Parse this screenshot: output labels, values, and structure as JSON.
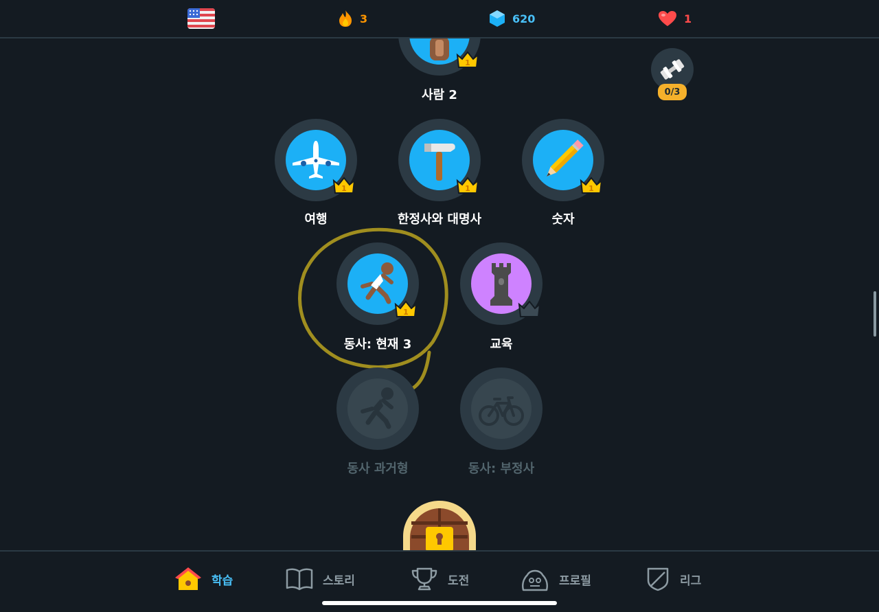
{
  "header": {
    "flag_icon": "us-flag-icon",
    "streak": {
      "icon": "fire-icon",
      "value": "3",
      "color": "#ff9600"
    },
    "gems": {
      "icon": "gem-icon",
      "value": "620",
      "color": "#49c0f8"
    },
    "hearts": {
      "icon": "heart-icon",
      "value": "1",
      "color": "#ff4b4b"
    }
  },
  "practice": {
    "icon": "dumbbell-icon",
    "progress": "0/3"
  },
  "skills": [
    {
      "id": "people-2",
      "label": "사람 2",
      "icon": "person-icon",
      "level": "1",
      "state": "completed"
    },
    {
      "id": "travel",
      "label": "여행",
      "icon": "airplane-icon",
      "level": "1",
      "state": "completed"
    },
    {
      "id": "articles",
      "label": "한정사와 대명사",
      "icon": "hammer-icon",
      "level": "1",
      "state": "completed"
    },
    {
      "id": "numbers",
      "label": "숫자",
      "icon": "pencil-icon",
      "level": "1",
      "state": "completed"
    },
    {
      "id": "verbs-present-3",
      "label": "동사: 현재 3",
      "icon": "runner-icon",
      "level": "1",
      "state": "completed"
    },
    {
      "id": "education",
      "label": "교육",
      "icon": "chess-rook-icon",
      "level": "",
      "state": "active"
    },
    {
      "id": "verbs-past",
      "label": "동사 과거형",
      "icon": "runner-icon",
      "level": "",
      "state": "locked"
    },
    {
      "id": "verbs-negative",
      "label": "동사: 부정사",
      "icon": "bicycle-icon",
      "level": "",
      "state": "locked"
    }
  ],
  "checkpoint": {
    "icon": "castle-door-lock-icon"
  },
  "nav": [
    {
      "label": "학습",
      "icon": "home-icon",
      "active": true
    },
    {
      "label": "스토리",
      "icon": "book-icon",
      "active": false
    },
    {
      "label": "도전",
      "icon": "trophy-icon",
      "active": false
    },
    {
      "label": "프로필",
      "icon": "profile-icon",
      "active": false
    },
    {
      "label": "리그",
      "icon": "shield-icon",
      "active": false
    }
  ],
  "colors": {
    "background": "#141b22",
    "skill_blue": "#1cb0f6",
    "skill_purple": "#ce82ff",
    "crown_gold": "#ffc800",
    "nav_active": "#49c0f8"
  }
}
